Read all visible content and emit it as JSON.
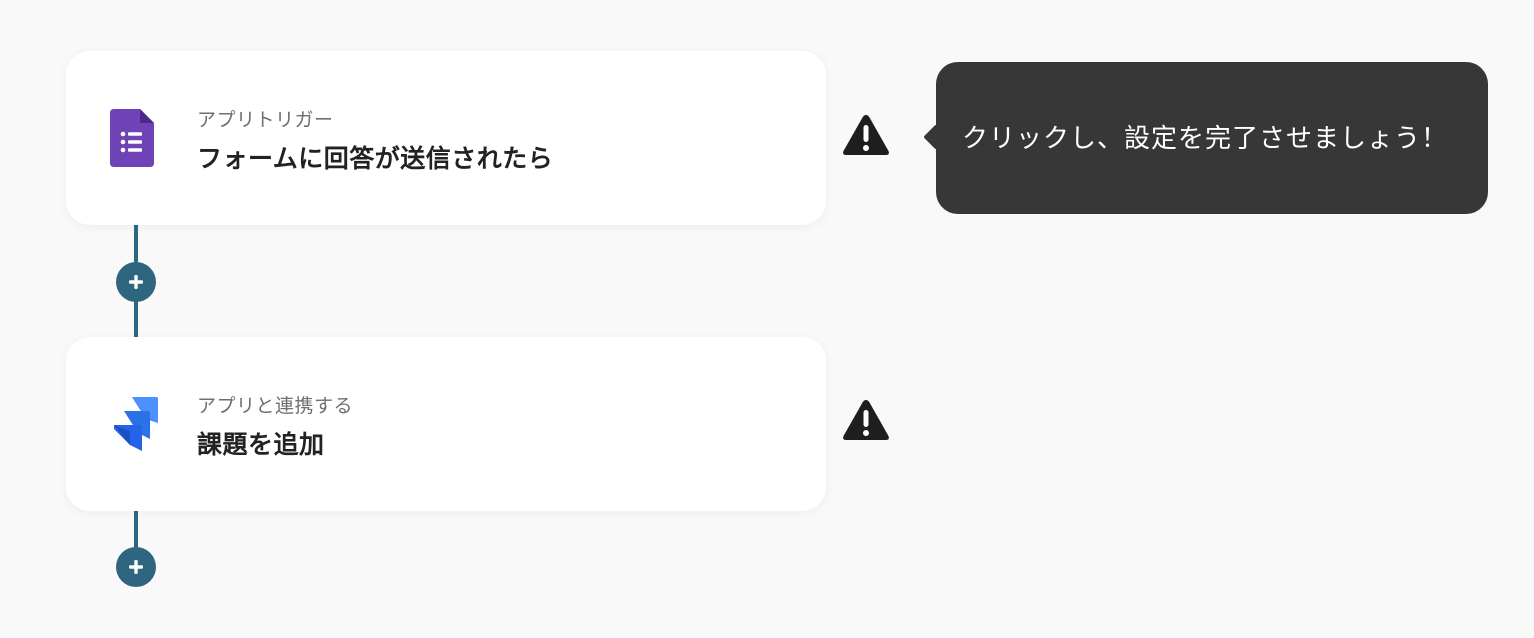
{
  "flow": {
    "steps": [
      {
        "subtitle": "アプリトリガー",
        "title": "フォームに回答が送信されたら",
        "icon": "google-forms-icon",
        "icon_color": "#6f42b6",
        "status": "warning"
      },
      {
        "subtitle": "アプリと連携する",
        "title": "課題を追加",
        "icon": "jira-icon",
        "icon_color": "#2a72e8",
        "status": "warning"
      }
    ],
    "connector_color": "#2e6680",
    "add_step_icon": "plus-icon"
  },
  "tooltip": {
    "text": "クリックし、設定を完了させましょう！",
    "background": "#373737"
  },
  "warning_icon": "warning-triangle-icon"
}
